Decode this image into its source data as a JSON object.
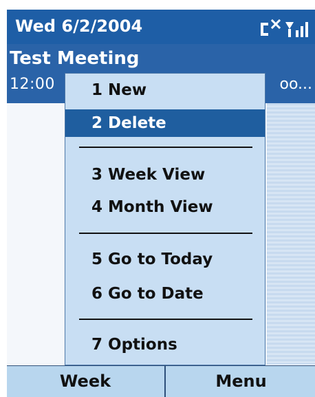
{
  "titlebar": {
    "date": "Wed 6/2/2004",
    "icons": [
      "connectivity-off-icon",
      "signal-icon"
    ]
  },
  "event": {
    "title": "Test Meeting",
    "time": "12:00",
    "location": "oo..."
  },
  "menu": {
    "items": [
      {
        "label": "1 New"
      },
      {
        "label": "2 Delete",
        "selected": true
      },
      {
        "label": "3 Week View"
      },
      {
        "label": "4 Month View"
      },
      {
        "label": "5 Go to Today"
      },
      {
        "label": "6 Go to Date"
      },
      {
        "label": "7 Options"
      }
    ]
  },
  "softkeys": {
    "left": "Week",
    "right": "Menu"
  },
  "colors": {
    "titlebar": "#1e5ea6",
    "selection": "#1f5e9f",
    "menu_background": "#c8def3",
    "softkey_background": "#b8d6ee"
  }
}
